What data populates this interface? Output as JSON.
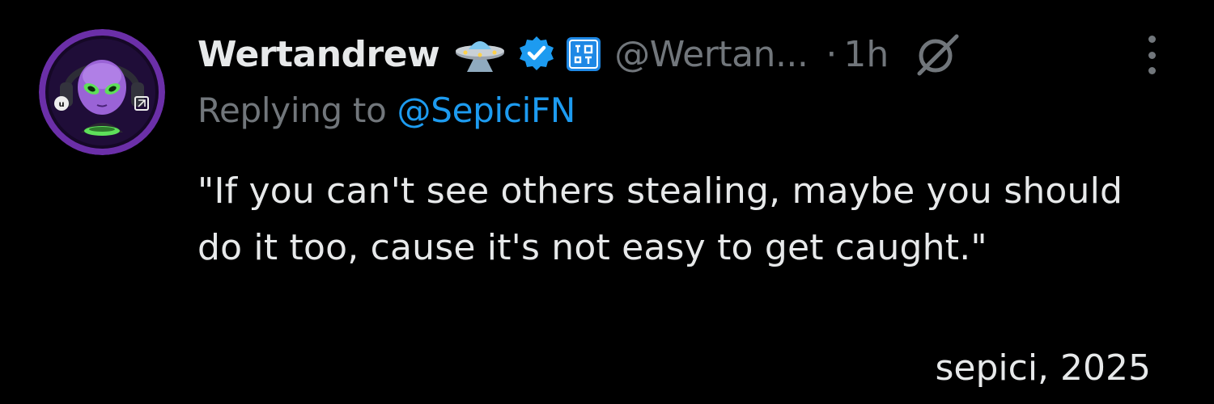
{
  "tweet": {
    "author": {
      "display_name": "Wertandrew",
      "handle": "@Wertan...",
      "avatar_icon": "alien-gamer-avatar",
      "emoji_icon": "flying-saucer-icon",
      "verified_icon": "verified-badge-icon",
      "affiliation_icon": "blue-square-badge-icon"
    },
    "separator": "·",
    "time": "1h",
    "extra_icon": "null-sign-icon",
    "more_icon": "more-vertical-icon",
    "reply": {
      "prefix": "Replying to ",
      "mention": "@SepiciFN"
    },
    "text": "\"If you can't see others stealing, maybe you should do it too, cause it's not easy to get caught.\"",
    "signature": "sepici, 2025"
  },
  "colors": {
    "background": "#000000",
    "primary_text": "#e7e9ea",
    "secondary_text": "#71767b",
    "link": "#1d9bf0",
    "verified": "#1d9bf0",
    "avatar_ring": "#6b2fa8"
  }
}
